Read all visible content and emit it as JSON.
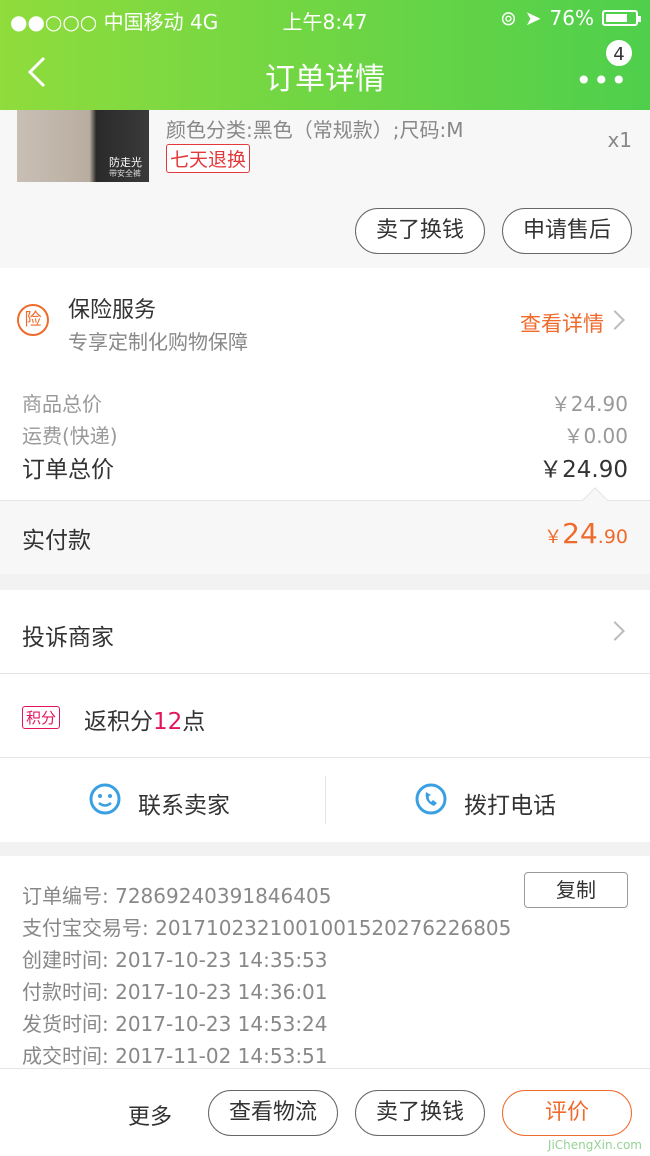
{
  "statusbar": {
    "signal": "●●○○○ 中国移动  4G",
    "time": "上午8:47",
    "battery": "76%",
    "battery_level": 0.76
  },
  "navbar": {
    "title": "订单详情",
    "more": "•••",
    "badge": "4"
  },
  "product": {
    "spec": "颜色分类:黑色（常规款）;尺码:M",
    "qty": "x1",
    "return_tag": "七天退换",
    "thumb_tag1": "防走光",
    "thumb_tag2": "带安全裤"
  },
  "product_actions": {
    "sell": "卖了换钱",
    "after_sale": "申请售后"
  },
  "insurance": {
    "icon_text": "险",
    "title": "保险服务",
    "subtitle": "专享定制化购物保障",
    "link": "查看详情"
  },
  "prices": {
    "goods_label": "商品总价",
    "goods_value": "￥24.90",
    "shipping_label": "运费(快递)",
    "shipping_value": "￥0.00",
    "total_label": "订单总价",
    "total_value": "￥24.90"
  },
  "paid": {
    "label": "实付款",
    "currency": "￥",
    "int": "24",
    "dec": ".90"
  },
  "complain": {
    "label": "投诉商家"
  },
  "points": {
    "badge": "积分",
    "prefix": "返积分",
    "num": "12",
    "suffix": "点"
  },
  "contact": {
    "seller": "联系卖家",
    "phone": "拨打电话"
  },
  "info": {
    "copy": "复制",
    "rows": [
      "订单编号:  72869240391846405",
      "支付宝交易号:  2017102321001001520276226805",
      "创建时间:  2017-10-23 14:35:53",
      "付款时间:  2017-10-23 14:36:01",
      "发货时间:  2017-10-23 14:53:24",
      "成交时间:  2017-11-02 14:53:51"
    ]
  },
  "bottom": {
    "more": "更多",
    "logistics": "查看物流",
    "sell": "卖了换钱",
    "rate": "评价"
  },
  "watermark": "JiChengXin.com"
}
